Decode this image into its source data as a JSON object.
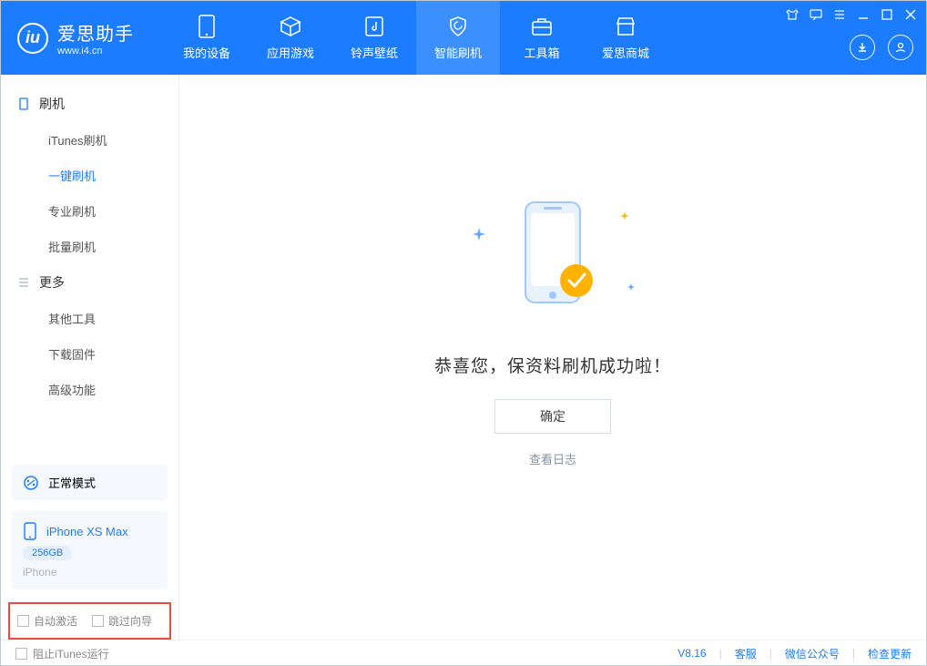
{
  "app": {
    "name": "爱思助手",
    "site": "www.i4.cn"
  },
  "nav": {
    "items": [
      {
        "label": "我的设备"
      },
      {
        "label": "应用游戏"
      },
      {
        "label": "铃声壁纸"
      },
      {
        "label": "智能刷机"
      },
      {
        "label": "工具箱"
      },
      {
        "label": "爱思商城"
      }
    ]
  },
  "sidebar": {
    "section1": {
      "title": "刷机",
      "items": [
        "iTunes刷机",
        "一键刷机",
        "专业刷机",
        "批量刷机"
      ]
    },
    "section2": {
      "title": "更多",
      "items": [
        "其他工具",
        "下载固件",
        "高级功能"
      ]
    }
  },
  "mode": {
    "label": "正常模式"
  },
  "device": {
    "name": "iPhone XS Max",
    "capacity": "256GB",
    "type": "iPhone"
  },
  "options": {
    "auto_activate": "自动激活",
    "skip_guide": "跳过向导"
  },
  "main": {
    "message": "恭喜您，保资料刷机成功啦！",
    "ok": "确定",
    "view_log": "查看日志"
  },
  "footer": {
    "block_itunes": "阻止iTunes运行",
    "version": "V8.16",
    "links": [
      "客服",
      "微信公众号",
      "检查更新"
    ]
  }
}
